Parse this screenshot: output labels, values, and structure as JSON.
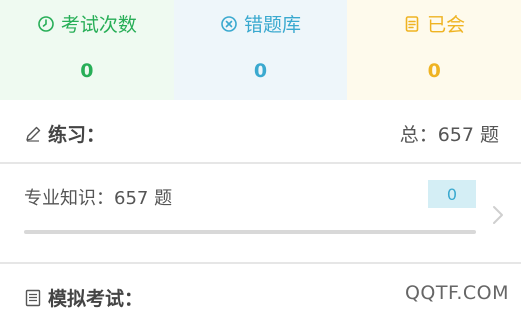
{
  "stats": [
    {
      "label": "考试次数",
      "value": "0",
      "icon": "clock-icon",
      "color": "#27ae57"
    },
    {
      "label": "错题库",
      "value": "0",
      "icon": "x-circle-icon",
      "color": "#3aa9cf"
    },
    {
      "label": "已会",
      "value": "0",
      "icon": "document-icon",
      "color": "#efb322"
    }
  ],
  "practice": {
    "title": "练习：",
    "total": "总：657 题",
    "icon": "pencil-icon"
  },
  "knowledge": {
    "label": "专业知识：657 题",
    "badge": "0",
    "progress": 0
  },
  "mock_exam": {
    "title": "模拟考试：",
    "icon": "list-icon"
  },
  "watermark": "QQTF.COM"
}
